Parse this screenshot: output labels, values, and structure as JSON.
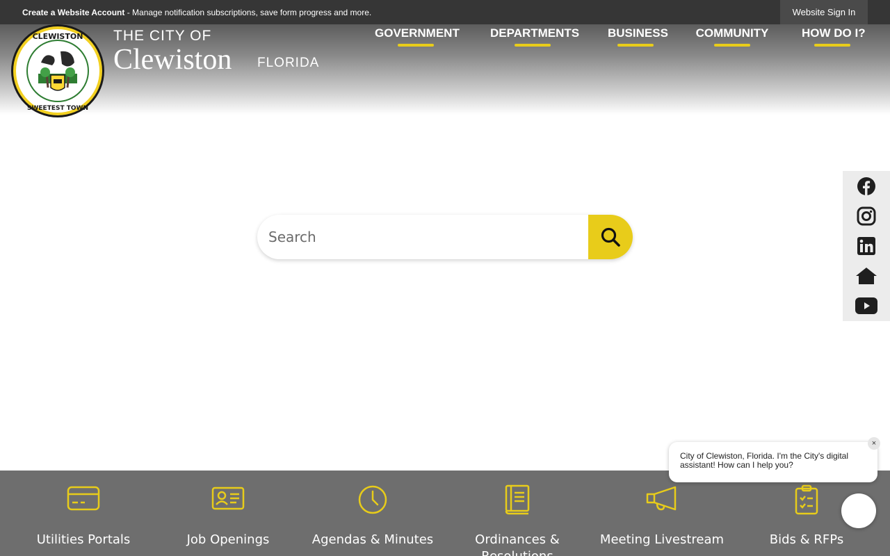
{
  "topbar": {
    "create_account": "Create a Website Account",
    "message": " - Manage notification subscriptions, save form progress and more.",
    "sign_in": "Website Sign In"
  },
  "brand": {
    "line1": "THE CITY OF",
    "line2": "Clewiston",
    "line3": "FLORIDA",
    "seal_icon": "city-seal-icon",
    "seal_text": "CLEWISTON FLORIDA · AMERICA'S SWEETEST TOWN"
  },
  "nav": {
    "items": [
      {
        "label": "GOVERNMENT"
      },
      {
        "label": "DEPARTMENTS"
      },
      {
        "label": "BUSINESS"
      },
      {
        "label": "COMMUNITY"
      },
      {
        "label": "HOW DO I?"
      }
    ]
  },
  "search": {
    "placeholder": "Search",
    "button_icon": "search-icon"
  },
  "social": {
    "items": [
      {
        "icon": "facebook-icon"
      },
      {
        "icon": "instagram-icon"
      },
      {
        "icon": "linkedin-icon"
      },
      {
        "icon": "home-icon"
      },
      {
        "icon": "youtube-icon"
      }
    ]
  },
  "quick_links": {
    "items": [
      {
        "label": "Utilities Portals",
        "icon": "credit-card-icon"
      },
      {
        "label": "Job Openings",
        "icon": "id-card-icon"
      },
      {
        "label": "Agendas & Minutes",
        "icon": "clock-icon"
      },
      {
        "label": "Ordinances & Resolutions",
        "icon": "book-icon"
      },
      {
        "label": "Meeting Livestream",
        "icon": "megaphone-icon"
      },
      {
        "label": "Bids & RFPs",
        "icon": "clipboard-icon"
      }
    ]
  },
  "chat": {
    "message": "City of Clewiston, Florida. I'm the City's digital assistant! How can I help you?",
    "close": "×"
  },
  "colors": {
    "accent": "#e8cc1a",
    "topbar": "#363636",
    "quick_links_bg": "#6e6e6e"
  }
}
